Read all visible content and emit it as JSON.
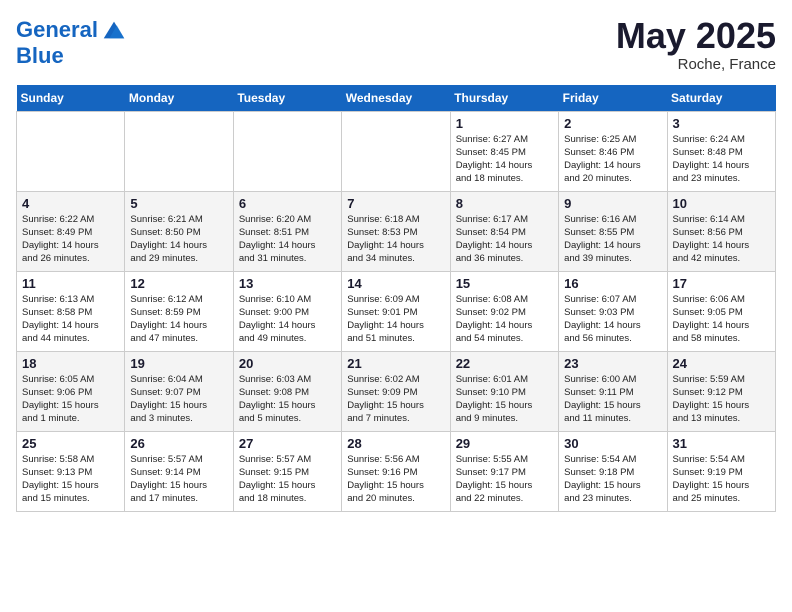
{
  "header": {
    "logo_line1": "General",
    "logo_line2": "Blue",
    "month": "May 2025",
    "location": "Roche, France"
  },
  "weekdays": [
    "Sunday",
    "Monday",
    "Tuesday",
    "Wednesday",
    "Thursday",
    "Friday",
    "Saturday"
  ],
  "weeks": [
    [
      {
        "day": "",
        "info": ""
      },
      {
        "day": "",
        "info": ""
      },
      {
        "day": "",
        "info": ""
      },
      {
        "day": "",
        "info": ""
      },
      {
        "day": "1",
        "info": "Sunrise: 6:27 AM\nSunset: 8:45 PM\nDaylight: 14 hours\nand 18 minutes."
      },
      {
        "day": "2",
        "info": "Sunrise: 6:25 AM\nSunset: 8:46 PM\nDaylight: 14 hours\nand 20 minutes."
      },
      {
        "day": "3",
        "info": "Sunrise: 6:24 AM\nSunset: 8:48 PM\nDaylight: 14 hours\nand 23 minutes."
      }
    ],
    [
      {
        "day": "4",
        "info": "Sunrise: 6:22 AM\nSunset: 8:49 PM\nDaylight: 14 hours\nand 26 minutes."
      },
      {
        "day": "5",
        "info": "Sunrise: 6:21 AM\nSunset: 8:50 PM\nDaylight: 14 hours\nand 29 minutes."
      },
      {
        "day": "6",
        "info": "Sunrise: 6:20 AM\nSunset: 8:51 PM\nDaylight: 14 hours\nand 31 minutes."
      },
      {
        "day": "7",
        "info": "Sunrise: 6:18 AM\nSunset: 8:53 PM\nDaylight: 14 hours\nand 34 minutes."
      },
      {
        "day": "8",
        "info": "Sunrise: 6:17 AM\nSunset: 8:54 PM\nDaylight: 14 hours\nand 36 minutes."
      },
      {
        "day": "9",
        "info": "Sunrise: 6:16 AM\nSunset: 8:55 PM\nDaylight: 14 hours\nand 39 minutes."
      },
      {
        "day": "10",
        "info": "Sunrise: 6:14 AM\nSunset: 8:56 PM\nDaylight: 14 hours\nand 42 minutes."
      }
    ],
    [
      {
        "day": "11",
        "info": "Sunrise: 6:13 AM\nSunset: 8:58 PM\nDaylight: 14 hours\nand 44 minutes."
      },
      {
        "day": "12",
        "info": "Sunrise: 6:12 AM\nSunset: 8:59 PM\nDaylight: 14 hours\nand 47 minutes."
      },
      {
        "day": "13",
        "info": "Sunrise: 6:10 AM\nSunset: 9:00 PM\nDaylight: 14 hours\nand 49 minutes."
      },
      {
        "day": "14",
        "info": "Sunrise: 6:09 AM\nSunset: 9:01 PM\nDaylight: 14 hours\nand 51 minutes."
      },
      {
        "day": "15",
        "info": "Sunrise: 6:08 AM\nSunset: 9:02 PM\nDaylight: 14 hours\nand 54 minutes."
      },
      {
        "day": "16",
        "info": "Sunrise: 6:07 AM\nSunset: 9:03 PM\nDaylight: 14 hours\nand 56 minutes."
      },
      {
        "day": "17",
        "info": "Sunrise: 6:06 AM\nSunset: 9:05 PM\nDaylight: 14 hours\nand 58 minutes."
      }
    ],
    [
      {
        "day": "18",
        "info": "Sunrise: 6:05 AM\nSunset: 9:06 PM\nDaylight: 15 hours\nand 1 minute."
      },
      {
        "day": "19",
        "info": "Sunrise: 6:04 AM\nSunset: 9:07 PM\nDaylight: 15 hours\nand 3 minutes."
      },
      {
        "day": "20",
        "info": "Sunrise: 6:03 AM\nSunset: 9:08 PM\nDaylight: 15 hours\nand 5 minutes."
      },
      {
        "day": "21",
        "info": "Sunrise: 6:02 AM\nSunset: 9:09 PM\nDaylight: 15 hours\nand 7 minutes."
      },
      {
        "day": "22",
        "info": "Sunrise: 6:01 AM\nSunset: 9:10 PM\nDaylight: 15 hours\nand 9 minutes."
      },
      {
        "day": "23",
        "info": "Sunrise: 6:00 AM\nSunset: 9:11 PM\nDaylight: 15 hours\nand 11 minutes."
      },
      {
        "day": "24",
        "info": "Sunrise: 5:59 AM\nSunset: 9:12 PM\nDaylight: 15 hours\nand 13 minutes."
      }
    ],
    [
      {
        "day": "25",
        "info": "Sunrise: 5:58 AM\nSunset: 9:13 PM\nDaylight: 15 hours\nand 15 minutes."
      },
      {
        "day": "26",
        "info": "Sunrise: 5:57 AM\nSunset: 9:14 PM\nDaylight: 15 hours\nand 17 minutes."
      },
      {
        "day": "27",
        "info": "Sunrise: 5:57 AM\nSunset: 9:15 PM\nDaylight: 15 hours\nand 18 minutes."
      },
      {
        "day": "28",
        "info": "Sunrise: 5:56 AM\nSunset: 9:16 PM\nDaylight: 15 hours\nand 20 minutes."
      },
      {
        "day": "29",
        "info": "Sunrise: 5:55 AM\nSunset: 9:17 PM\nDaylight: 15 hours\nand 22 minutes."
      },
      {
        "day": "30",
        "info": "Sunrise: 5:54 AM\nSunset: 9:18 PM\nDaylight: 15 hours\nand 23 minutes."
      },
      {
        "day": "31",
        "info": "Sunrise: 5:54 AM\nSunset: 9:19 PM\nDaylight: 15 hours\nand 25 minutes."
      }
    ]
  ]
}
